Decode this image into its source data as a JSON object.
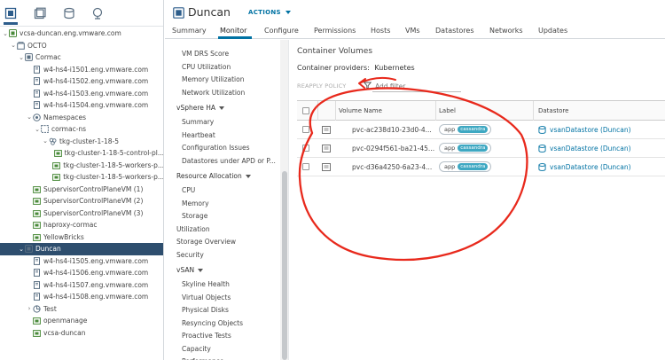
{
  "colors": {
    "accent": "#0072a3",
    "selected_bg": "#2e4e6e",
    "tag_bg": "#3ea8c2",
    "annotation": "#e8291c"
  },
  "toolbar": {
    "icons": [
      "hosts-clusters-icon",
      "vms-templates-icon",
      "storage-icon",
      "networking-icon"
    ]
  },
  "tree": [
    {
      "label": "vcsa-duncan.eng.vmware.com",
      "icon": "vcenter-icon",
      "depth": 0,
      "expanded": true
    },
    {
      "label": "OCTO",
      "icon": "datacenter-icon",
      "depth": 1,
      "expanded": true
    },
    {
      "label": "Cormac",
      "icon": "cluster-icon",
      "depth": 2,
      "expanded": true
    },
    {
      "label": "w4-hs4-i1501.eng.vmware.com",
      "icon": "host-icon",
      "depth": 3
    },
    {
      "label": "w4-hs4-i1502.eng.vmware.com",
      "icon": "host-icon",
      "depth": 3
    },
    {
      "label": "w4-hs4-i1503.eng.vmware.com",
      "icon": "host-icon",
      "depth": 3
    },
    {
      "label": "w4-hs4-i1504.eng.vmware.com",
      "icon": "host-icon",
      "depth": 3
    },
    {
      "label": "Namespaces",
      "icon": "namespaces-icon",
      "depth": 3,
      "expanded": true
    },
    {
      "label": "cormac-ns",
      "icon": "namespace-icon",
      "depth": 4,
      "expanded": true
    },
    {
      "label": "tkg-cluster-1-18-5",
      "icon": "tkg-cluster-icon",
      "depth": 5,
      "expanded": true
    },
    {
      "label": "tkg-cluster-1-18-5-control-pl...",
      "icon": "vm-icon",
      "depth": 6
    },
    {
      "label": "tkg-cluster-1-18-5-workers-p...",
      "icon": "vm-icon",
      "depth": 6
    },
    {
      "label": "tkg-cluster-1-18-5-workers-p...",
      "icon": "vm-icon",
      "depth": 6
    },
    {
      "label": "SupervisorControlPlaneVM (1)",
      "icon": "vm-icon",
      "depth": 3
    },
    {
      "label": "SupervisorControlPlaneVM (2)",
      "icon": "vm-icon",
      "depth": 3
    },
    {
      "label": "SupervisorControlPlaneVM (3)",
      "icon": "vm-icon",
      "depth": 3
    },
    {
      "label": "haproxy-cormac",
      "icon": "vm-icon",
      "depth": 3
    },
    {
      "label": "YellowBricks",
      "icon": "vm-icon",
      "depth": 3
    },
    {
      "label": "Duncan",
      "icon": "cluster-icon",
      "depth": 2,
      "expanded": true,
      "selected": true
    },
    {
      "label": "w4-hs4-i1505.eng.vmware.com",
      "icon": "host-icon",
      "depth": 3
    },
    {
      "label": "w4-hs4-i1506.eng.vmware.com",
      "icon": "host-icon",
      "depth": 3
    },
    {
      "label": "w4-hs4-i1507.eng.vmware.com",
      "icon": "host-icon",
      "depth": 3
    },
    {
      "label": "w4-hs4-i1508.eng.vmware.com",
      "icon": "host-icon",
      "depth": 3
    },
    {
      "label": "Test",
      "icon": "resource-pool-icon",
      "depth": 3,
      "collapsed": true
    },
    {
      "label": "openmanage",
      "icon": "vm-icon",
      "depth": 3
    },
    {
      "label": "vcsa-duncan",
      "icon": "vm-icon",
      "depth": 3
    }
  ],
  "header": {
    "title": "Duncan",
    "actions_label": "ACTIONS",
    "tabs": [
      "Summary",
      "Monitor",
      "Configure",
      "Permissions",
      "Hosts",
      "VMs",
      "Datastores",
      "Networks",
      "Updates"
    ],
    "active_tab": "Monitor"
  },
  "subnav": [
    {
      "label": "VM DRS Score",
      "kind": "item"
    },
    {
      "label": "CPU Utilization",
      "kind": "item"
    },
    {
      "label": "Memory Utilization",
      "kind": "item"
    },
    {
      "label": "Network Utilization",
      "kind": "item"
    },
    {
      "label": "vSphere HA",
      "kind": "head"
    },
    {
      "label": "Summary",
      "kind": "item"
    },
    {
      "label": "Heartbeat",
      "kind": "item"
    },
    {
      "label": "Configuration Issues",
      "kind": "item"
    },
    {
      "label": "Datastores under APD or P...",
      "kind": "item"
    },
    {
      "label": "Resource Allocation",
      "kind": "head"
    },
    {
      "label": "CPU",
      "kind": "item"
    },
    {
      "label": "Memory",
      "kind": "item"
    },
    {
      "label": "Storage",
      "kind": "item"
    },
    {
      "label": "Utilization",
      "kind": "plain"
    },
    {
      "label": "Storage Overview",
      "kind": "plain"
    },
    {
      "label": "Security",
      "kind": "plain"
    },
    {
      "label": "vSAN",
      "kind": "head"
    },
    {
      "label": "Skyline Health",
      "kind": "item"
    },
    {
      "label": "Virtual Objects",
      "kind": "item"
    },
    {
      "label": "Physical Disks",
      "kind": "item"
    },
    {
      "label": "Resyncing Objects",
      "kind": "item"
    },
    {
      "label": "Proactive Tests",
      "kind": "item"
    },
    {
      "label": "Capacity",
      "kind": "item"
    },
    {
      "label": "Performance",
      "kind": "item"
    }
  ],
  "main": {
    "heading": "Container Volumes",
    "providers_label": "Container providers:",
    "providers_value": "Kubernetes",
    "reapply_label": "REAPPLY POLICY",
    "filter_placeholder": "Add filter",
    "columns": {
      "volume_name": "Volume Name",
      "label": "Label",
      "datastore": "Datastore"
    },
    "rows": [
      {
        "volume_name": "pvc-ac238d10-23d0-4...",
        "label_key": "app",
        "label_value": "cassandra",
        "datastore": "vsanDatastore (Duncan)"
      },
      {
        "volume_name": "pvc-0294f561-ba21-45...",
        "label_key": "app",
        "label_value": "cassandra",
        "datastore": "vsanDatastore (Duncan)"
      },
      {
        "volume_name": "pvc-d36a4250-6a23-4...",
        "label_key": "app",
        "label_value": "cassandra",
        "datastore": "vsanDatastore (Duncan)"
      }
    ]
  }
}
